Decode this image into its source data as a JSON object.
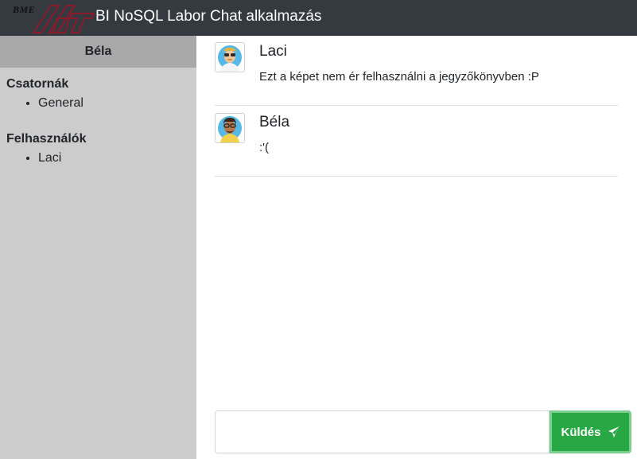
{
  "app": {
    "logo_text": "BME",
    "title": "BI NoSQL Labor Chat alkalmazás"
  },
  "sidebar": {
    "current_user": "Béla",
    "channels_title": "Csatornák",
    "channels": [
      "General"
    ],
    "users_title": "Felhasználók",
    "users": [
      "Laci"
    ]
  },
  "messages": [
    {
      "author": "Laci",
      "text": "Ezt a képet nem ér felhasználni a jegyzőkönyvben :P",
      "avatar": "avatar-laci-icon"
    },
    {
      "author": "Béla",
      "text": ":'(",
      "avatar": "avatar-bela-icon"
    }
  ],
  "composer": {
    "input_value": "",
    "send_label": "Küldés",
    "send_icon": "paper-plane-icon"
  },
  "colors": {
    "navbar": "#343a40",
    "sidebar": "#cccccc",
    "sidebar_header": "#a8a8a8",
    "send_button": "#28a745",
    "logo_red": "#8b1a2b"
  }
}
